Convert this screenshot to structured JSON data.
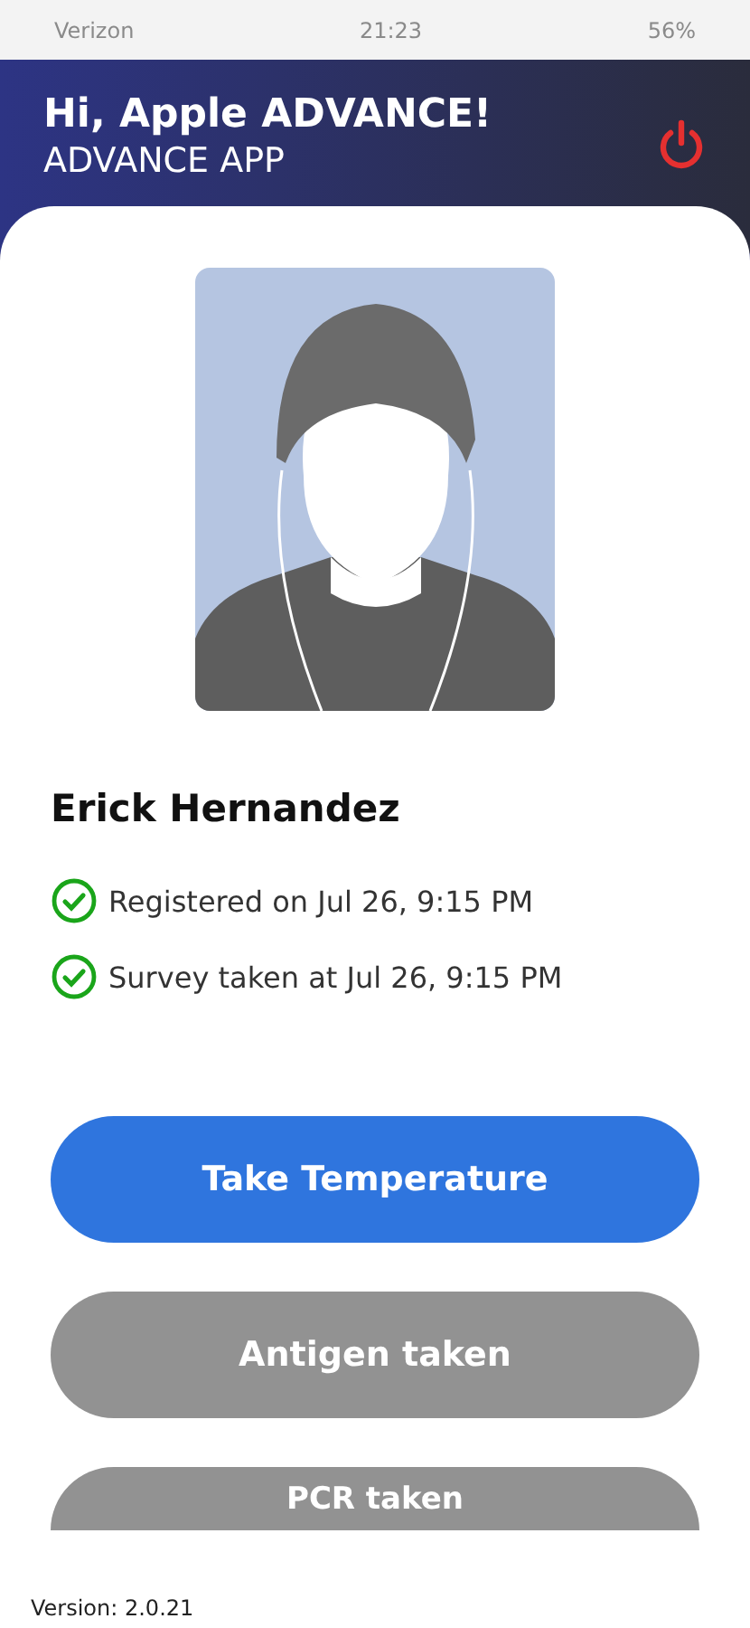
{
  "status_bar": {
    "carrier": "Verizon",
    "time": "21:23",
    "battery": "56%"
  },
  "header": {
    "greeting": "Hi, Apple ADVANCE!",
    "subtitle": "ADVANCE APP"
  },
  "profile": {
    "name": "Erick Hernandez"
  },
  "events": [
    {
      "label": "Registered on Jul 26, 9:15 PM",
      "done": true
    },
    {
      "label": "Survey taken at Jul 26, 9:15 PM",
      "done": true
    }
  ],
  "buttons": [
    {
      "label": "Take Temperature",
      "disabled": false
    },
    {
      "label": "Antigen taken",
      "disabled": true
    },
    {
      "label": "PCR taken",
      "disabled": true
    }
  ],
  "footer": {
    "version": "Version: 2.0.21"
  }
}
